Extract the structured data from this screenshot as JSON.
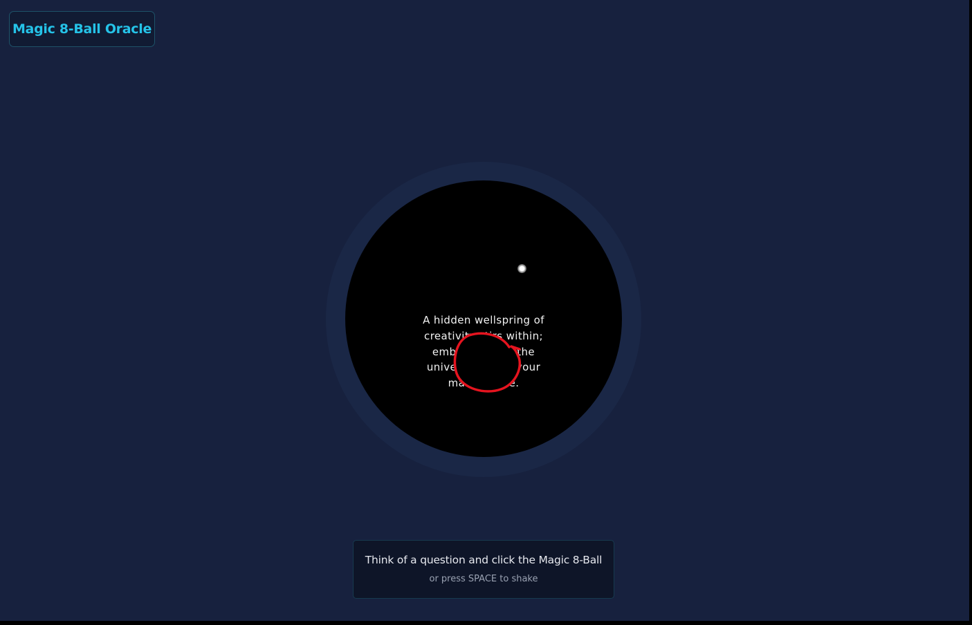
{
  "app": {
    "title": "Magic 8-Ball Oracle"
  },
  "ball": {
    "answer": "A hidden wellspring of creativity stirs within; embrace it, for the universe awaits your masterpiece."
  },
  "instructions": {
    "primary": "Think of a question and click the Magic 8-Ball",
    "secondary": "or press SPACE to shake"
  },
  "colors": {
    "background": "#17213e",
    "accent": "#25c3e8",
    "ball": "#000000",
    "annotation": "#e5141f"
  }
}
